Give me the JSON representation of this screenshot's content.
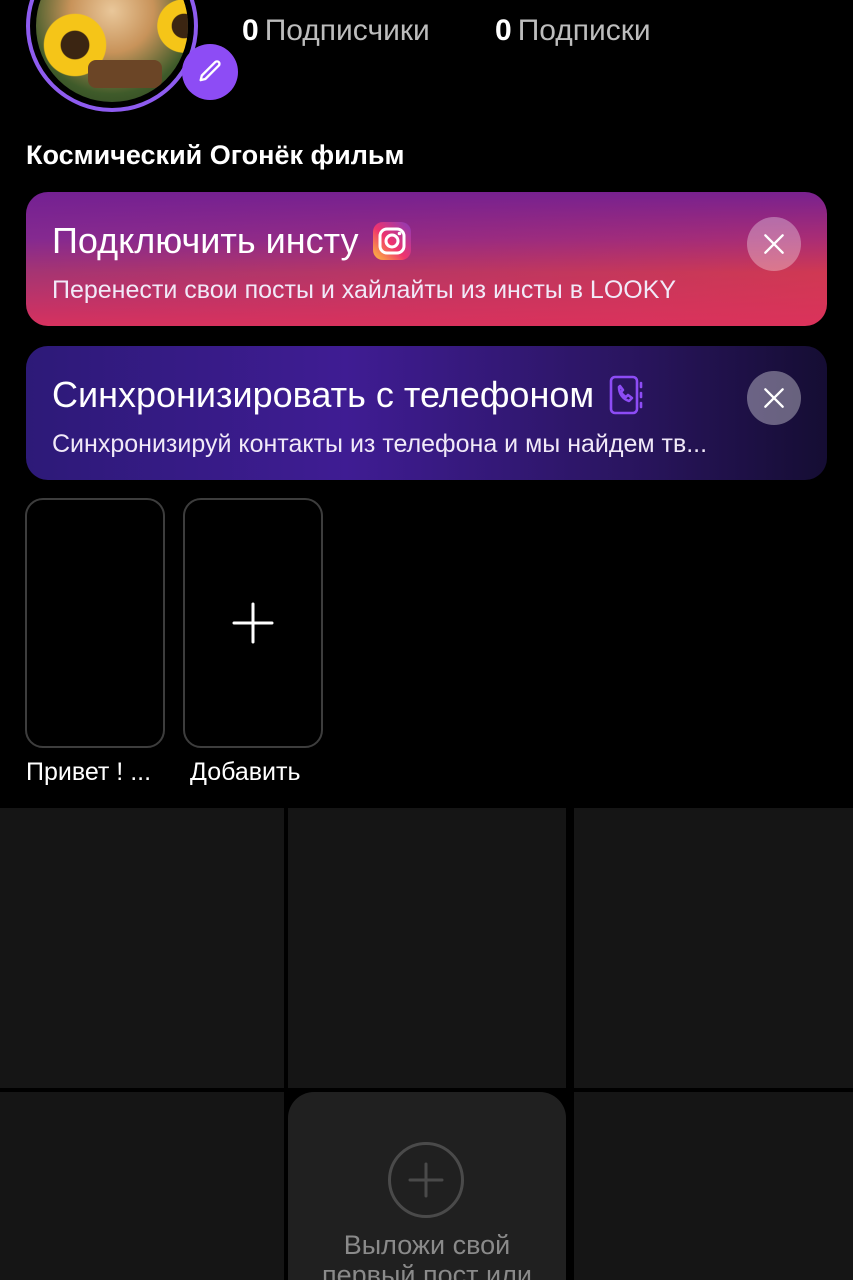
{
  "profile": {
    "name": "Космический Огонёк фильм",
    "followers_count": "0",
    "followers_label": "Подписчики",
    "following_count": "0",
    "following_label": "Подписки"
  },
  "banners": {
    "instagram": {
      "title": "Подключить инсту",
      "subtitle": "Перенести свои посты и хайлайты из инсты в LOOKY",
      "icon": "instagram-icon"
    },
    "sync": {
      "title": "Синхронизировать с телефоном",
      "subtitle": "Синхронизируй контакты из телефона и мы найдем тв...",
      "icon": "phone-book-icon"
    }
  },
  "highlights": [
    {
      "label": "Привет ! ..."
    },
    {
      "label": "Добавить",
      "icon": "plus-icon"
    }
  ],
  "empty_post": {
    "text_line1": "Выложи свой",
    "text_line2": "первый пост или"
  },
  "colors": {
    "accent": "#8d4cf5",
    "background": "#000000",
    "grid_cell": "#151515"
  }
}
